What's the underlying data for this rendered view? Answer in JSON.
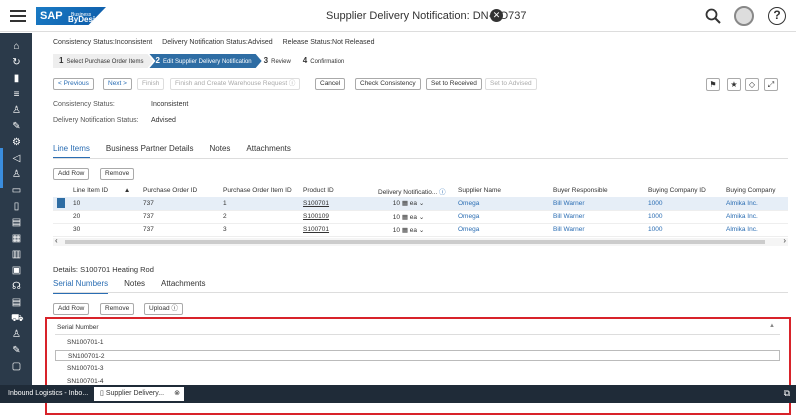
{
  "shell": {
    "brand": "SAP",
    "brand_sub": "Business",
    "brand_name": "ByDesign",
    "title": "Supplier Delivery Notification: DN-PO737"
  },
  "status": {
    "consistency": "Consistency Status:Inconsistent",
    "delivery": "Delivery Notification Status:Advised",
    "release": "Release Status:Not Released"
  },
  "steps": [
    {
      "num": "1",
      "label": "Select Purchase Order Items"
    },
    {
      "num": "2",
      "label": "Edit Supplier Delivery Notification"
    },
    {
      "num": "3",
      "label": "Review"
    },
    {
      "num": "4",
      "label": "Confirmation"
    }
  ],
  "toolbar": {
    "previous": "< Previous",
    "next": "Next >",
    "finish": "Finish",
    "finish_wh": "Finish and Create Warehouse Request ⓘ",
    "cancel": "Cancel",
    "check": "Check Consistency",
    "set_received": "Set to Received",
    "set_advised": "Set to Advised"
  },
  "fields": {
    "consistency_label": "Consistency Status:",
    "consistency_value": "Inconsistent",
    "delivery_label": "Delivery Notification Status:",
    "delivery_value": "Advised"
  },
  "tabs": [
    "Line Items",
    "Business Partner Details",
    "Notes",
    "Attachments"
  ],
  "line_actions": {
    "add_row": "Add Row",
    "remove": "Remove"
  },
  "grid": {
    "headers": [
      "Line Item ID",
      "Purchase Order ID",
      "Purchase Order Item ID",
      "Product ID",
      "Delivery Notificatio...",
      "Supplier Name",
      "Buyer Responsible",
      "Buying Company ID",
      "Buying Company"
    ],
    "rows": [
      [
        "10",
        "737",
        "1",
        "S100701",
        "10",
        "ea",
        "Omega",
        "Bill Warner",
        "1000",
        "Almika Inc."
      ],
      [
        "20",
        "737",
        "2",
        "S100109",
        "10",
        "ea",
        "Omega",
        "Bill Warner",
        "1000",
        "Almika Inc."
      ],
      [
        "30",
        "737",
        "3",
        "S100701",
        "10",
        "ea",
        "Omega",
        "Bill Warner",
        "1000",
        "Almika Inc."
      ]
    ]
  },
  "details": {
    "title": "Details: S100701 Heating Rod",
    "tabs": [
      "Serial Numbers",
      "Notes",
      "Attachments"
    ],
    "add_row": "Add Row",
    "remove": "Remove",
    "upload": "Upload ⓘ",
    "serial_header": "Serial Number",
    "serials": [
      "SN100701-1",
      "SN100701-2",
      "SN100701-3",
      "SN100701-4"
    ]
  },
  "taskbar": {
    "item1": "Inbound Logistics - Inbo...",
    "item2": "Supplier Delivery..."
  }
}
